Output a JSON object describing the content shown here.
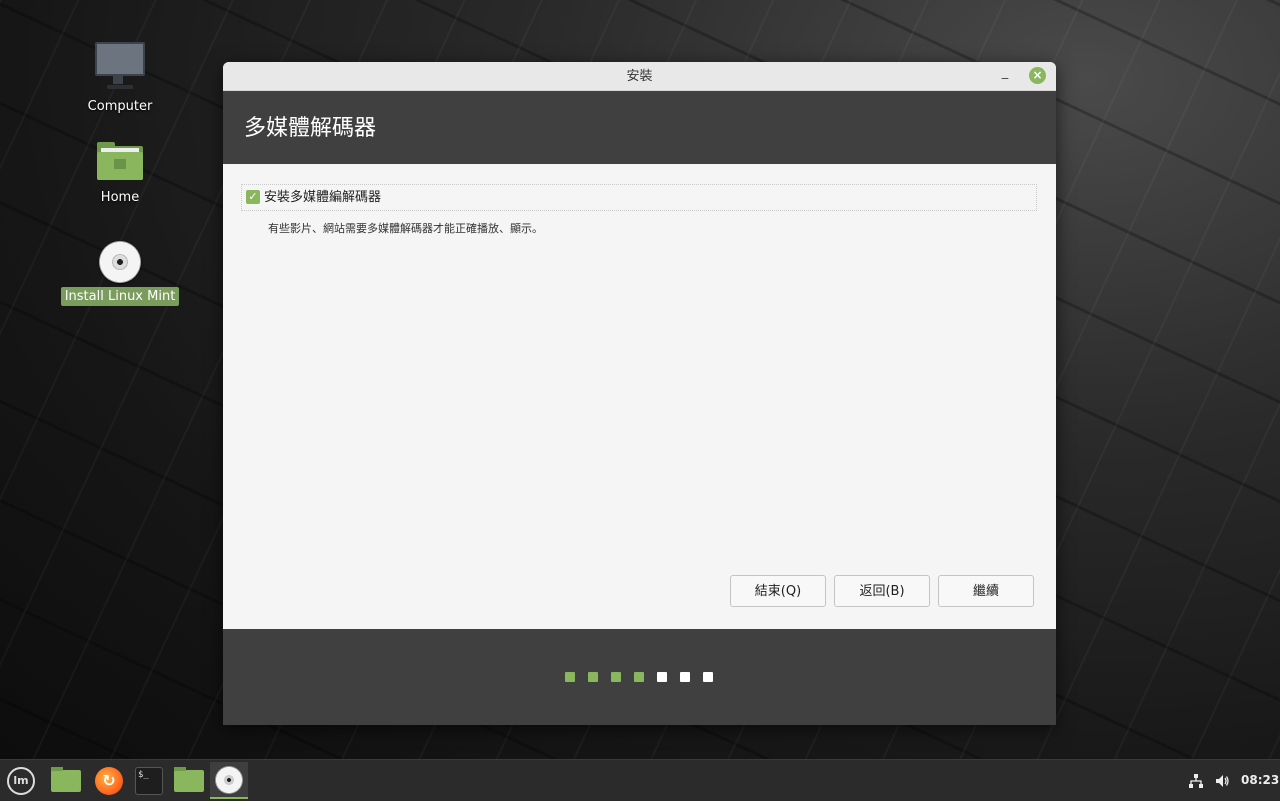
{
  "desktop": {
    "icons": [
      {
        "label": "Computer"
      },
      {
        "label": "Home"
      },
      {
        "label": "Install Linux Mint"
      }
    ]
  },
  "window": {
    "title": "安裝",
    "header_title": "多媒體解碼器",
    "option_label": "安裝多媒體編解碼器",
    "option_checked": true,
    "description": "有些影片、網站需要多媒體解碼器才能正確播放、顯示。",
    "buttons": {
      "quit": "結束(Q)",
      "back": "返回(B)",
      "continue": "繼續"
    },
    "progress": {
      "completed_steps": 4,
      "total_steps": 7,
      "done_color": "#8ab65e",
      "todo_color": "#ffffff"
    }
  },
  "taskbar": {
    "clock": "08:23"
  }
}
